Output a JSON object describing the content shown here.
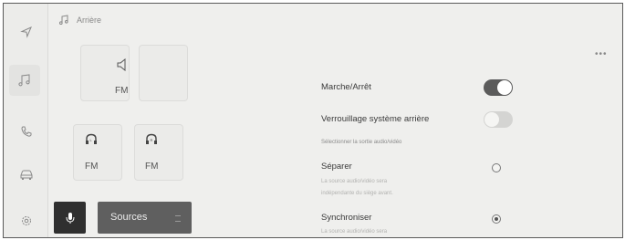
{
  "header": {
    "title": "Arrière"
  },
  "rail": {
    "items": [
      "navigation-icon",
      "music-icon",
      "phone-icon",
      "car-icon",
      "settings-icon"
    ]
  },
  "zones": {
    "front": {
      "source": "FM"
    },
    "rear_left": {
      "source": "FM"
    },
    "rear_right": {
      "source": "FM"
    }
  },
  "bottom": {
    "sources_label": "Sources"
  },
  "settings": {
    "power": {
      "label": "Marche/Arrêt",
      "on": true
    },
    "lock": {
      "label": "Verrouillage système arrière",
      "on": false
    },
    "output_caption": "Sélectionner la sortie audio/vidéo",
    "separate": {
      "label": "Séparer",
      "desc_line1": "La source audio/vidéo sera",
      "desc_line2": "indépendante du siège avant.",
      "selected": false
    },
    "sync": {
      "label": "Synchroniser",
      "desc_line1": "La source audio/vidéo sera",
      "selected": true
    }
  },
  "colors": {
    "toggle_on": "#5b5b5b",
    "toggle_off": "#d4d4d2",
    "sources_bg": "#5f5f5f",
    "mic_bg": "#2f2f2f"
  }
}
